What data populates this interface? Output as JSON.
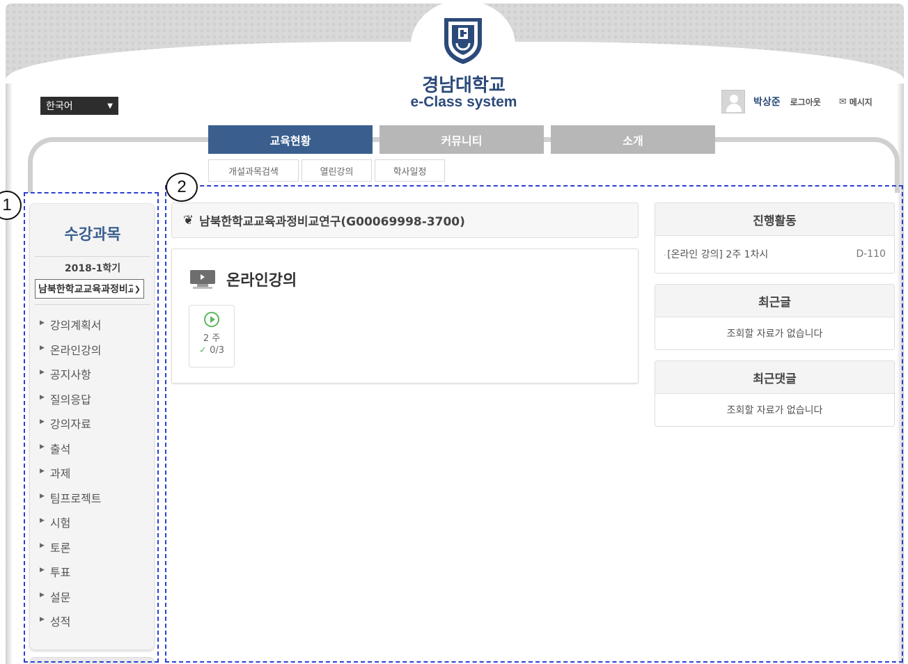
{
  "header": {
    "university_name": "경남대학교",
    "system_name": "e-Class system",
    "language_select": "한국어",
    "user_name": "박상준",
    "logout_label": "로그아웃",
    "message_label": "메시지"
  },
  "nav": {
    "main_tabs": [
      {
        "label": "교육현황"
      },
      {
        "label": "커뮤니티"
      },
      {
        "label": "소개"
      }
    ],
    "sub_tabs": [
      {
        "label": "개설과목검색"
      },
      {
        "label": "열린강의"
      },
      {
        "label": "학사일정"
      }
    ]
  },
  "sidebar": {
    "title": "수강과목",
    "term": "2018-1학기",
    "course_select": "남북한학교교육과정비교연구",
    "menu": [
      {
        "label": "강의계획서"
      },
      {
        "label": "온라인강의"
      },
      {
        "label": "공지사항"
      },
      {
        "label": "질의응답"
      },
      {
        "label": "강의자료"
      },
      {
        "label": "출석"
      },
      {
        "label": "과제"
      },
      {
        "label": "팀프로젝트"
      },
      {
        "label": "시험"
      },
      {
        "label": "토론"
      },
      {
        "label": "투표"
      },
      {
        "label": "설문"
      },
      {
        "label": "성적"
      }
    ]
  },
  "annotations": {
    "callout_1": "1",
    "callout_2": "2",
    "box_color": "#2b3fd1"
  },
  "main": {
    "course_title": "남북한학교교육과정비교연구(G00069998-3700)",
    "section_title": "온라인강의",
    "week_card": {
      "week": "2 주",
      "progress": "0/3"
    }
  },
  "right_panels": {
    "activity": {
      "title": "진행활동",
      "item": "[온라인 강의] 2주 1차시",
      "dday": "D-110"
    },
    "recent_posts": {
      "title": "최근글",
      "empty": "조회할 자료가 없습니다"
    },
    "recent_comments": {
      "title": "최근댓글",
      "empty": "조회할 자료가 없습니다"
    }
  },
  "colors": {
    "brand_blue": "#3a5f8f",
    "tab_inactive": "#b7b7b7",
    "success_green": "#5cb85c"
  }
}
